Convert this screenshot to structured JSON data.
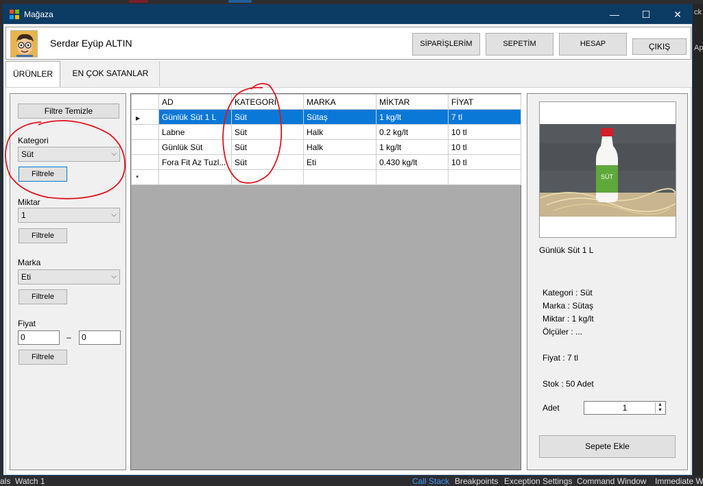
{
  "window": {
    "title": "Mağaza",
    "minimize": "—",
    "maximize": "☐",
    "close": "✕"
  },
  "header": {
    "username": "Serdar Eyüp ALTIN",
    "buttons": {
      "orders": "SİPARİŞLERİM",
      "cart": "SEPETİM",
      "account": "HESAP",
      "exit": "ÇIKIŞ"
    }
  },
  "tabs": {
    "products": "ÜRÜNLER",
    "best_sellers": "EN ÇOK SATANLAR"
  },
  "filters": {
    "clear_button": "Filtre Temizle",
    "category_label": "Kategori",
    "category_value": "Süt",
    "quantity_label": "Miktar",
    "quantity_value": "1",
    "brand_label": "Marka",
    "brand_value": "Eti",
    "price_label": "Fiyat",
    "price_min": "0",
    "price_sep": "–",
    "price_max": "0",
    "filter_button": "Filtrele"
  },
  "grid": {
    "columns": [
      "AD",
      "KATEGORİ",
      "MARKA",
      "MİKTAR",
      "FİYAT"
    ],
    "rows": [
      [
        "Günlük Süt 1 L",
        "Süt",
        "Sütaş",
        "1 kg/lt",
        "7 tl"
      ],
      [
        "Labne",
        "Süt",
        "Halk",
        "0.2 kg/lt",
        "10 tl"
      ],
      [
        "Günlük Süt",
        "Süt",
        "Halk",
        "1 kg/lt",
        "10 tl"
      ],
      [
        "Fora Fit Az Tuzl...",
        "Süt",
        "Eti",
        "0.430 kg/lt",
        "10 tl"
      ]
    ],
    "new_row_marker": "*"
  },
  "detail": {
    "product_name": "Günlük Süt 1 L",
    "category": "Kategori : Süt",
    "brand": "Marka : Sütaş",
    "quantity": "Miktar : 1 kg/lt",
    "dimensions": "Ölçüler : ...",
    "price": "Fiyat : 7 tl",
    "stock": "Stok : 50 Adet",
    "amount_label": "Adet",
    "amount_value": "1",
    "add_button": "Sepete Ekle",
    "image_label": "SÜT"
  },
  "ide": {
    "bottom_tabs": [
      "als",
      "Watch 1",
      "Call Stack",
      "Breakpoints",
      "Exception Settings",
      "Command Window",
      "Immediate W"
    ],
    "right_text": [
      "ck",
      "Ap"
    ]
  },
  "colors": {
    "titlebar": "#0c3b64",
    "selection": "#0a78d7",
    "annotation": "#e0141e"
  }
}
